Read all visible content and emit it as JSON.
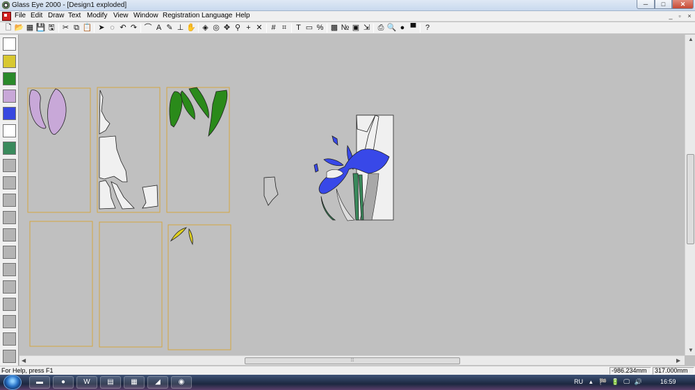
{
  "window": {
    "title": "Glass Eye 2000 - [Design1 exploded]",
    "min_symbol": "─",
    "max_symbol": "□",
    "close_symbol": "✕"
  },
  "menu": {
    "items": [
      "File",
      "Edit",
      "Draw",
      "Text",
      "Modify",
      "View",
      "Window",
      "Registration",
      "Language",
      "Help"
    ],
    "mdi_buttons": [
      "_",
      "▫",
      "×"
    ]
  },
  "toolbar": {
    "buttons": [
      {
        "name": "new-icon",
        "glyph": "🗋"
      },
      {
        "name": "open-icon",
        "glyph": "📂"
      },
      {
        "name": "grid-view-icon",
        "glyph": "▦"
      },
      {
        "name": "save-icon",
        "glyph": "💾"
      },
      {
        "name": "save-as-icon",
        "glyph": "🖫"
      },
      {
        "name": "cut-icon",
        "glyph": "✂"
      },
      {
        "name": "copy-icon",
        "glyph": "⧉"
      },
      {
        "name": "paste-icon",
        "glyph": "📋"
      },
      {
        "name": "pointer-icon",
        "glyph": "➤"
      },
      {
        "name": "lasso-icon",
        "glyph": "◌"
      },
      {
        "name": "undo-icon",
        "glyph": "↶"
      },
      {
        "name": "redo-icon",
        "glyph": "↷"
      },
      {
        "name": "curve-icon",
        "glyph": "⌒"
      },
      {
        "name": "text-tool-icon",
        "glyph": "A"
      },
      {
        "name": "pencil-icon",
        "glyph": "✎"
      },
      {
        "name": "stamp-icon",
        "glyph": "⊥"
      },
      {
        "name": "hand-icon",
        "glyph": "✋"
      },
      {
        "name": "fill-icon",
        "glyph": "◈"
      },
      {
        "name": "target-icon",
        "glyph": "◎"
      },
      {
        "name": "move-icon",
        "glyph": "✥"
      },
      {
        "name": "zoom-icon",
        "glyph": "⚲"
      },
      {
        "name": "crosshair-icon",
        "glyph": "+"
      },
      {
        "name": "cross-delete-icon",
        "glyph": "✕"
      },
      {
        "name": "grid-icon",
        "glyph": "#"
      },
      {
        "name": "snap-grid-icon",
        "glyph": "⌗"
      },
      {
        "name": "text-height-icon",
        "glyph": "T"
      },
      {
        "name": "ruler-icon",
        "glyph": "▭"
      },
      {
        "name": "percent-icon",
        "glyph": "%"
      },
      {
        "name": "color-grid-icon",
        "glyph": "▩"
      },
      {
        "name": "numbering-icon",
        "glyph": "№"
      },
      {
        "name": "image-icon",
        "glyph": "▣"
      },
      {
        "name": "import-icon",
        "glyph": "⇲"
      },
      {
        "name": "print-icon",
        "glyph": "⎙"
      },
      {
        "name": "print-preview-icon",
        "glyph": "🔍"
      },
      {
        "name": "bomb-icon",
        "glyph": "●"
      },
      {
        "name": "monitor-icon",
        "glyph": "▀"
      },
      {
        "name": "help-pointer-icon",
        "glyph": "?"
      }
    ]
  },
  "palette": {
    "swatches": [
      {
        "name": "swatch-clear",
        "color": "#ffffff"
      },
      {
        "name": "swatch-yellow-texture",
        "color": "#d8c830"
      },
      {
        "name": "swatch-green-texture",
        "color": "#2a8a2a"
      },
      {
        "name": "swatch-lilac-texture",
        "color": "#c8a8d8"
      },
      {
        "name": "swatch-blue-texture",
        "color": "#3848e0"
      },
      {
        "name": "swatch-white",
        "color": "#ffffff"
      },
      {
        "name": "swatch-sea-green",
        "color": "#3a8a5c"
      },
      {
        "name": "swatch-empty-1",
        "color": "#b4b4b4"
      },
      {
        "name": "swatch-empty-2",
        "color": "#b4b4b4"
      },
      {
        "name": "swatch-empty-3",
        "color": "#b4b4b4"
      },
      {
        "name": "swatch-empty-4",
        "color": "#b4b4b4"
      },
      {
        "name": "swatch-empty-5",
        "color": "#b4b4b4"
      },
      {
        "name": "swatch-empty-6",
        "color": "#b4b4b4"
      },
      {
        "name": "swatch-empty-7",
        "color": "#b4b4b4"
      },
      {
        "name": "swatch-empty-8",
        "color": "#b4b4b4"
      },
      {
        "name": "swatch-empty-9",
        "color": "#b4b4b4"
      },
      {
        "name": "swatch-empty-10",
        "color": "#b4b4b4"
      },
      {
        "name": "swatch-empty-11",
        "color": "#b4b4b4"
      },
      {
        "name": "swatch-empty-12",
        "color": "#b4b4b4"
      }
    ]
  },
  "colors": {
    "lilac": "#c8a8d8",
    "green": "#2a8a1a",
    "yellow": "#e0d020",
    "blue": "#3848e8",
    "white_glass": "#f0f0f0",
    "stem": "#3a8a5c",
    "sheet_border": "#d4a640",
    "canvas": "#c0c0c0"
  },
  "status": {
    "help_text": "For Help, press F1",
    "x_coord": "-986.234mm",
    "y_coord": "317.000mm"
  },
  "taskbar": {
    "lang": "RU",
    "time": "16:59",
    "tray_up": "▴",
    "tray_icons": "🏁 🔋 🖵 🔊"
  }
}
